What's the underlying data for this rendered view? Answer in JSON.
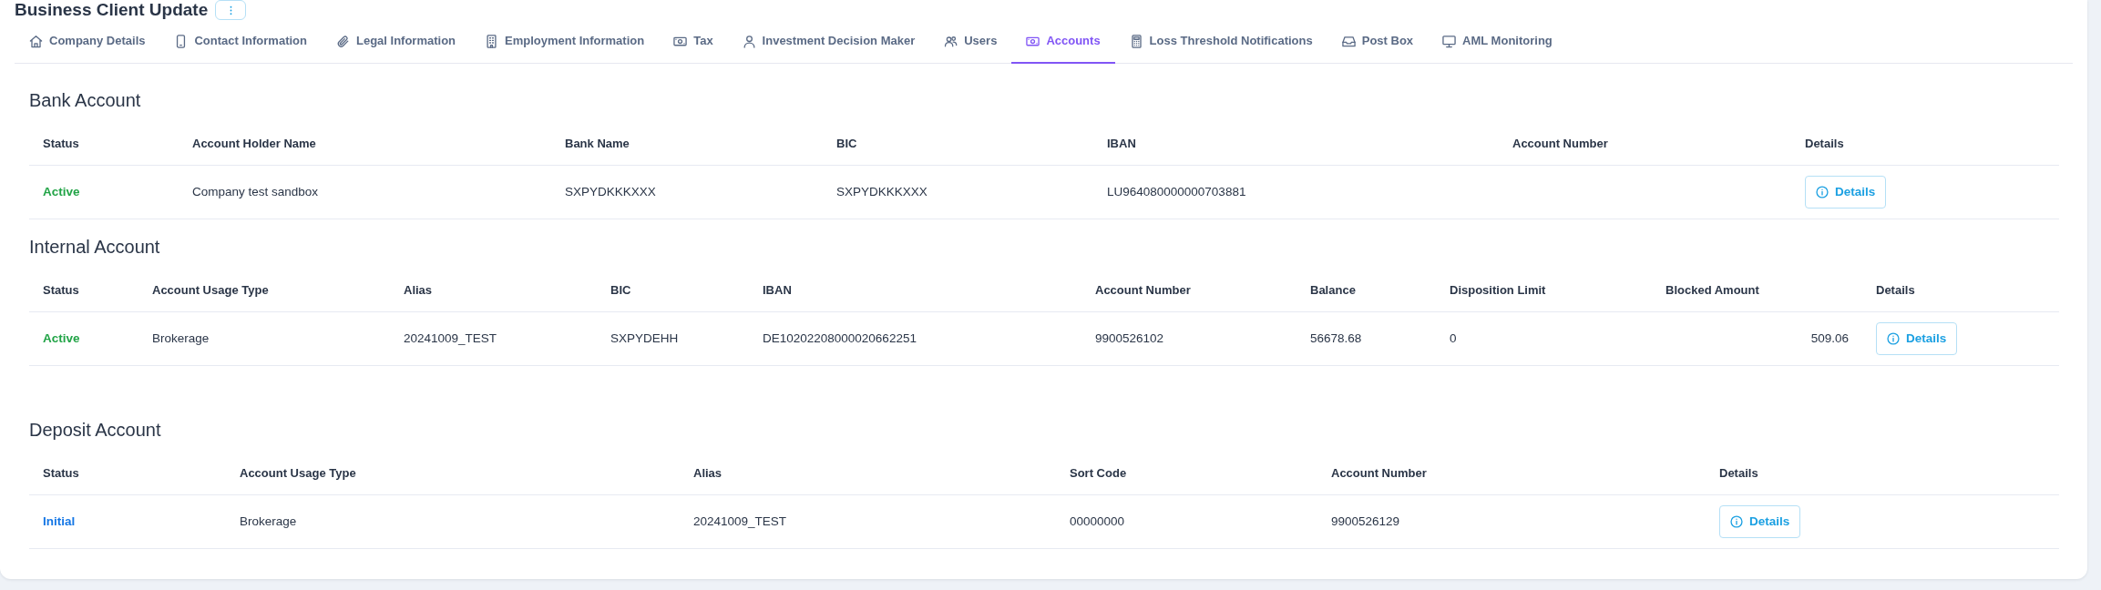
{
  "header": {
    "title": "Business Client Update"
  },
  "tabs": [
    {
      "label": "Company Details",
      "selected": false
    },
    {
      "label": "Contact Information",
      "selected": false
    },
    {
      "label": "Legal Information",
      "selected": false
    },
    {
      "label": "Employment Information",
      "selected": false
    },
    {
      "label": "Tax",
      "selected": false
    },
    {
      "label": "Investment Decision Maker",
      "selected": false
    },
    {
      "label": "Users",
      "selected": false
    },
    {
      "label": "Accounts",
      "selected": true
    },
    {
      "label": "Loss Threshold Notifications",
      "selected": false
    },
    {
      "label": "Post Box",
      "selected": false
    },
    {
      "label": "AML Monitoring",
      "selected": false
    }
  ],
  "sections": [
    {
      "title": "Bank Account",
      "table": {
        "columns": [
          "Status",
          "Account Holder Name",
          "Bank Name",
          "BIC",
          "IBAN",
          "Account Number",
          "Details"
        ],
        "rows": [
          {
            "cells": [
              {
                "kind": "status",
                "text": "Active",
                "color": "#22a447"
              },
              "Company test sandbox",
              "SXPYDKKKXXX",
              "SXPYDKKKXXX",
              "LU964080000000703881",
              "",
              {
                "kind": "button",
                "text": "Details"
              }
            ]
          }
        ]
      }
    },
    {
      "title": "Internal Account",
      "table": {
        "columns": [
          "Status",
          "Account Usage Type",
          "Alias",
          "BIC",
          "IBAN",
          "Account Number",
          "Balance",
          "Disposition Limit",
          "Blocked Amount",
          "Details"
        ],
        "rows": [
          {
            "cells": [
              {
                "kind": "status",
                "text": "Active",
                "color": "#22a447"
              },
              "Brokerage",
              "20241009_TEST",
              "SXPYDEHH",
              "DE10202208000020662251",
              "9900526102",
              "56678.68",
              "0",
              "509.06",
              {
                "kind": "button",
                "text": "Details"
              }
            ]
          }
        ]
      }
    },
    {
      "title": "Deposit Account",
      "table": {
        "columns": [
          "Status",
          "Account Usage Type",
          "Alias",
          "Sort Code",
          "Account Number",
          "Details"
        ],
        "rows": [
          {
            "cells": [
              {
                "kind": "status",
                "text": "Initial",
                "color": "#1677e5"
              },
              "Brokerage",
              "20241009_TEST",
              "00000000",
              "9900526129",
              {
                "kind": "button",
                "text": "Details"
              }
            ]
          }
        ]
      }
    }
  ]
}
